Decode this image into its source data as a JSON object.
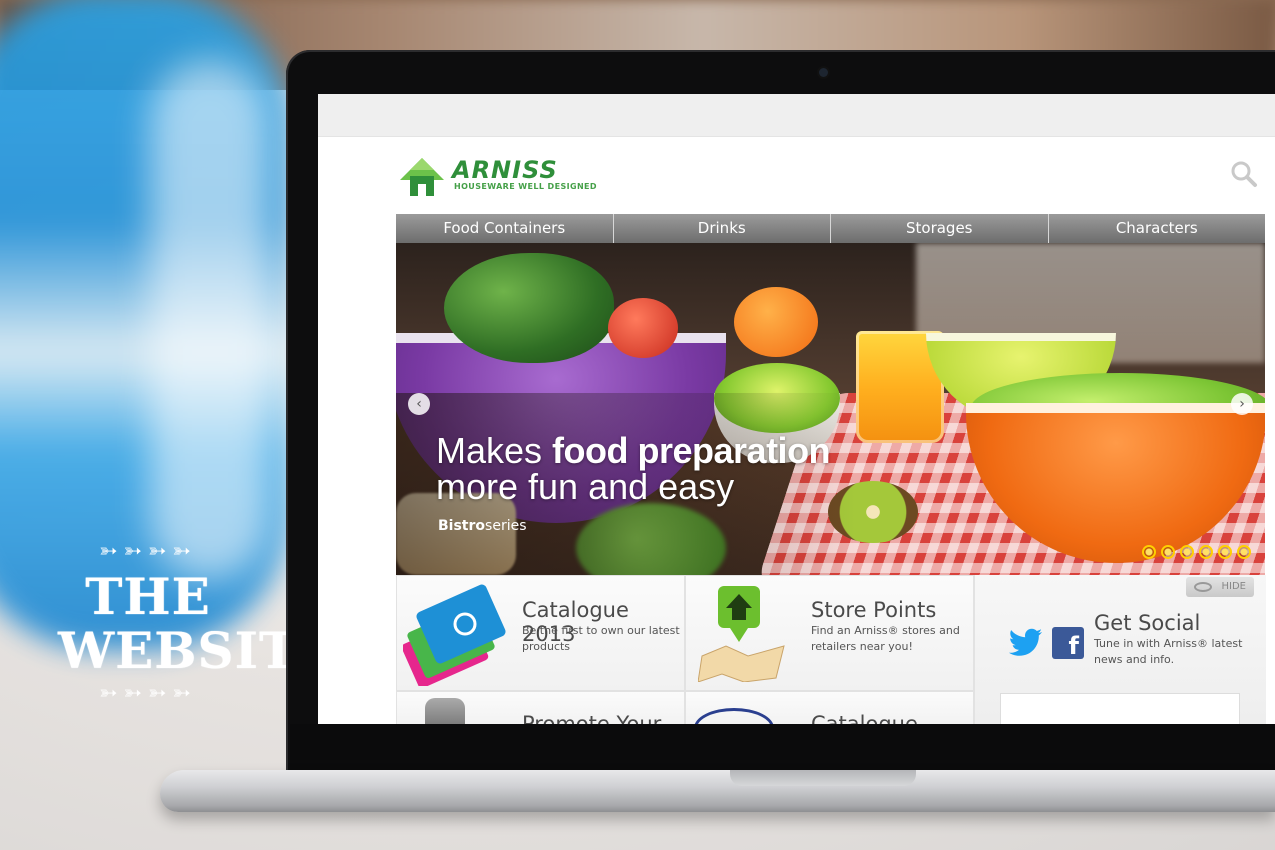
{
  "overlay": {
    "arrows_top": "➳➳➳➳",
    "arrows_bottom": "➳➳➳➳",
    "title_line1": "THE",
    "title_line2": "WEBSITE"
  },
  "site": {
    "brand": "ARNISS",
    "tagline": "HOUSEWARE WELL DESIGNED",
    "nav": [
      "Food Containers",
      "Drinks",
      "Storages",
      "Characters"
    ],
    "hero": {
      "line1_plain": "Makes ",
      "line1_bold": "food preparation",
      "line2": "more fun and easy",
      "series_bold": "Bistro",
      "series_plain": "series",
      "prev_arrow": "‹",
      "next_arrow": "›",
      "slide_count": 6
    },
    "panels": [
      {
        "title": "Catalogue 2013",
        "desc": "Be the first to own our latest products"
      },
      {
        "title": "Store Points",
        "desc": "Find an Arniss® stores and retailers near you!"
      },
      {
        "title": "Get Social",
        "desc": "Tune in with Arniss® latest news and info."
      }
    ],
    "hide_label": "HIDE",
    "lower_titles": [
      "Promote Your",
      "Catalogue"
    ],
    "facebook_glyph": "f"
  },
  "colors": {
    "brand_green": "#2f8f3a",
    "nav_gray": "#7a7a7a",
    "dot_yellow": "#ffd000",
    "facebook_blue": "#3b5998",
    "twitter_blue": "#1da1f2"
  }
}
